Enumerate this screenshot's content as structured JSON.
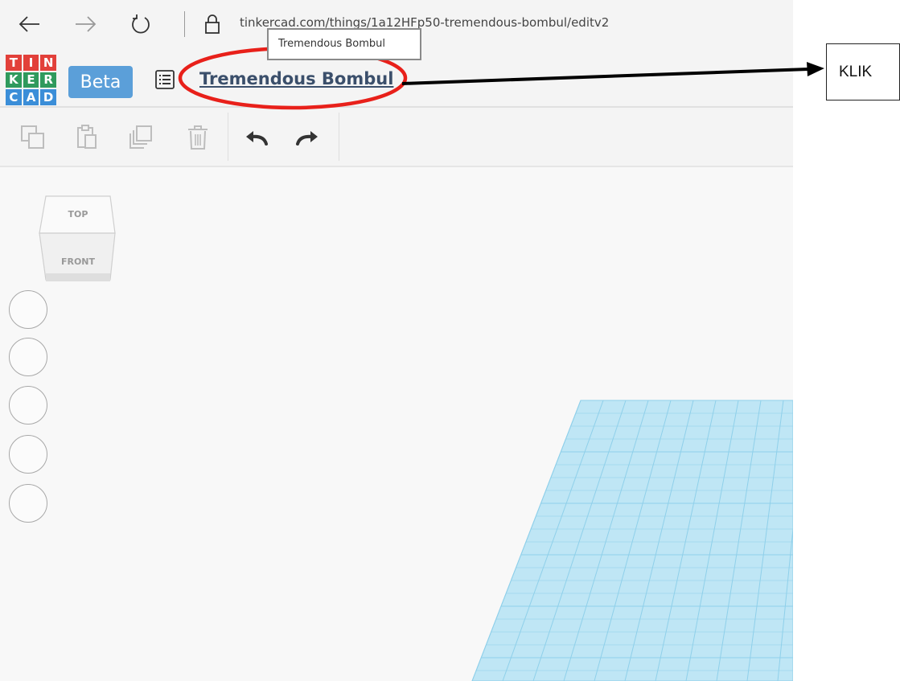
{
  "browser": {
    "url_text": "tinkercad.com/things/1a12HFp50-tremendous-bombul/editv2",
    "nav_icons": [
      "back-arrow-icon",
      "forward-arrow-icon",
      "refresh-icon",
      "lock-icon"
    ]
  },
  "tooltip": {
    "text": "Tremendous Bombul"
  },
  "app": {
    "logo_letters": [
      "T",
      "I",
      "N",
      "K",
      "E",
      "R",
      "C",
      "A",
      "D"
    ],
    "logo_colors": [
      "#e2403a",
      "#e2403a",
      "#e2403a",
      "#2f9a5d",
      "#2f9a5d",
      "#2f9a5d",
      "#3b8ed8",
      "#3b8ed8",
      "#3b8ed8"
    ],
    "beta_label": "Beta",
    "design_title": "Tremendous Bombul",
    "accent": "#5b9fd9"
  },
  "toolbar": {
    "tools": [
      "copy-icon",
      "paste-icon",
      "duplicate-icon",
      "delete-icon",
      "undo-icon",
      "redo-icon"
    ]
  },
  "view_cube": {
    "top_label": "TOP",
    "front_label": "FRONT"
  },
  "view_controls": {
    "count": 5
  },
  "annotation": {
    "label": "KLIK",
    "highlight_color": "#e8201a"
  }
}
